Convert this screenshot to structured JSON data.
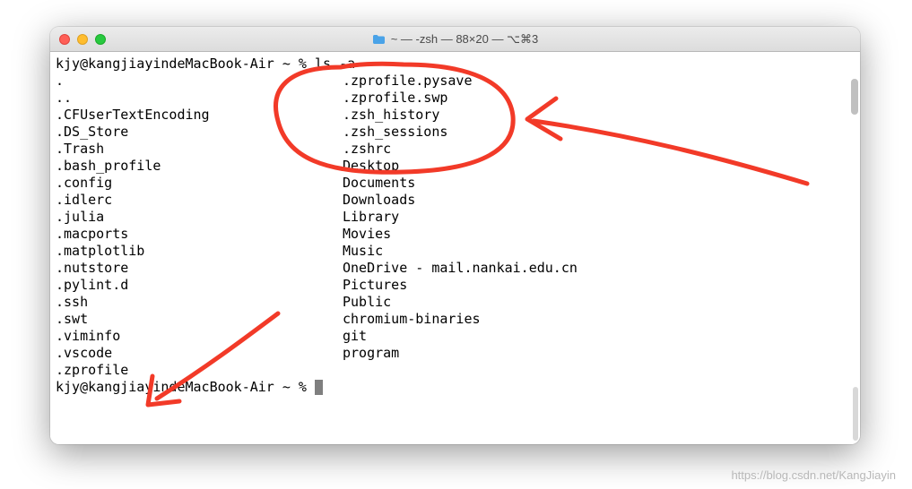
{
  "window": {
    "title": "~ — -zsh — 88×20 — ⌥⌘3"
  },
  "prompt": {
    "line1_prefix": "kjy@kangjiayindeMacBook-Air ~ % ",
    "line1_cmd": "ls -a",
    "line2_prefix": "kjy@kangjiayindeMacBook-Air ~ % "
  },
  "listing": {
    "col1": [
      ".",
      "..",
      ".CFUserTextEncoding",
      ".DS_Store",
      ".Trash",
      ".bash_profile",
      ".config",
      ".idlerc",
      ".julia",
      ".macports",
      ".matplotlib",
      ".nutstore",
      ".pylint.d",
      ".ssh",
      ".swt",
      ".viminfo",
      ".vscode",
      ".zprofile"
    ],
    "col2": [
      ".zprofile.pysave",
      ".zprofile.swp",
      ".zsh_history",
      ".zsh_sessions",
      ".zshrc",
      "Desktop",
      "Documents",
      "Downloads",
      "Library",
      "Movies",
      "Music",
      "OneDrive - mail.nankai.edu.cn",
      "Pictures",
      "Public",
      "chromium-binaries",
      "git",
      "program"
    ]
  },
  "watermark": "https://blog.csdn.net/KangJiayin"
}
